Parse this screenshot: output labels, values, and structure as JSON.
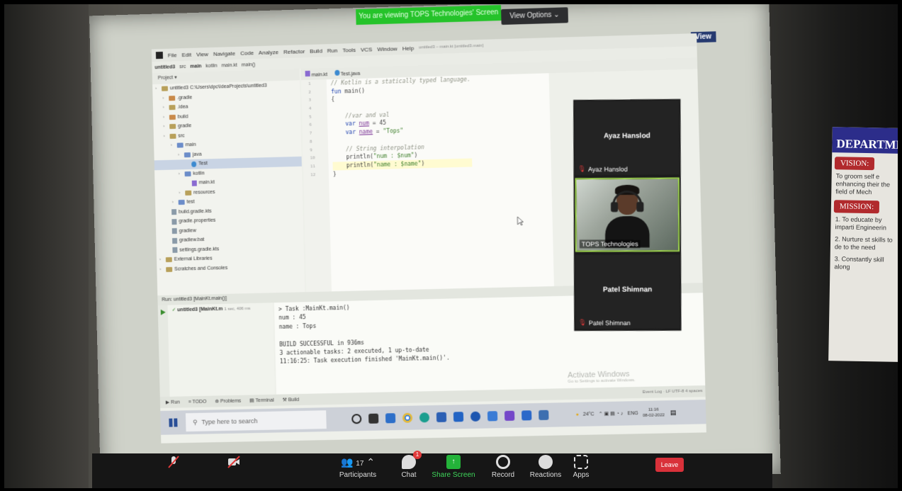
{
  "zoom": {
    "share_banner": "You are viewing TOPS Technologies' Screen",
    "view_options": "View Options ⌄",
    "view_label": "View",
    "participants": [
      {
        "name_large": "Ayaz Hanslod",
        "label": "Ayaz Hanslod",
        "has_video": false
      },
      {
        "name_large": "",
        "label": "TOPS Technologies",
        "has_video": true
      },
      {
        "name_large": "Patel Shimnan",
        "label": "Patel Shimnan",
        "has_video": false
      }
    ],
    "toolbar": {
      "participants_count": "17",
      "participants_label": "Participants",
      "chat_label": "Chat",
      "chat_badge": "1",
      "share_label": "Share Screen",
      "record_label": "Record",
      "reactions_label": "Reactions",
      "apps_label": "Apps",
      "leave_label": "Leave"
    }
  },
  "ide": {
    "menu": [
      "File",
      "Edit",
      "View",
      "Navigate",
      "Code",
      "Analyze",
      "Refactor",
      "Build",
      "Run",
      "Tools",
      "VCS",
      "Window",
      "Help"
    ],
    "window_path": "untitled3 – main.kt [untitled3.main]",
    "breadcrumb": [
      "untitled3",
      "src",
      "main",
      "kotlin",
      "main.kt",
      "main()"
    ],
    "project_header": "Project ▾",
    "tree": [
      {
        "label": "untitled3  C:\\Users\\dpc\\IdeaProjects\\untitled3",
        "indent": 0,
        "icon": "folder"
      },
      {
        "label": ".gradle",
        "indent": 1,
        "icon": "orange"
      },
      {
        "label": ".idea",
        "indent": 1,
        "icon": "folder"
      },
      {
        "label": "build",
        "indent": 1,
        "icon": "orange"
      },
      {
        "label": "gradle",
        "indent": 1,
        "icon": "folder"
      },
      {
        "label": "src",
        "indent": 1,
        "icon": "folder"
      },
      {
        "label": "main",
        "indent": 2,
        "icon": "blue"
      },
      {
        "label": "java",
        "indent": 3,
        "icon": "blue"
      },
      {
        "label": "Test",
        "indent": 4,
        "icon": "java",
        "selected": true
      },
      {
        "label": "kotlin",
        "indent": 3,
        "icon": "blue"
      },
      {
        "label": "main.kt",
        "indent": 4,
        "icon": "kt"
      },
      {
        "label": "resources",
        "indent": 3,
        "icon": "folder"
      },
      {
        "label": "test",
        "indent": 2,
        "icon": "blue"
      },
      {
        "label": "build.gradle.kts",
        "indent": 1,
        "icon": "file"
      },
      {
        "label": "gradle.properties",
        "indent": 1,
        "icon": "file"
      },
      {
        "label": "gradlew",
        "indent": 1,
        "icon": "file"
      },
      {
        "label": "gradlew.bat",
        "indent": 1,
        "icon": "file"
      },
      {
        "label": "settings.gradle.kts",
        "indent": 1,
        "icon": "file"
      },
      {
        "label": "External Libraries",
        "indent": 0,
        "icon": "folder"
      },
      {
        "label": "Scratches and Consoles",
        "indent": 0,
        "icon": "folder"
      }
    ],
    "editor_tabs": [
      "main.kt",
      "Test.java"
    ],
    "line_numbers": [
      "1",
      "2",
      "3",
      "4",
      "5",
      "6",
      "7",
      "8",
      "9",
      "10",
      "11",
      "12"
    ],
    "code": {
      "l1": "// Kotlin is a statically typed language.",
      "l2_kw": "fun ",
      "l2_rest": "main()",
      "l3": "{",
      "l4": "",
      "l5": "    //var and val",
      "l6_kw": "    var ",
      "l6_var": "num",
      "l6_rest": " = 45",
      "l7_kw": "    var ",
      "l7_var": "name",
      "l7_rest": " = ",
      "l7_str": "\"Tops\"",
      "l8": "",
      "l9": "    // String interpolation",
      "l10_a": "    println(",
      "l10_str": "\"num : $num\"",
      "l10_b": ")",
      "l11_a": "    println(",
      "l11_str": "\"name : $name\"",
      "l11_b": ")",
      "l12": "}"
    },
    "run_header": "Run:   untitled3 [MainKt.main()]",
    "run_item": "untitled3 [MainKt.m",
    "run_time": "1 sec, 406 ms",
    "console": [
      "> Task :MainKt.main()",
      "num : 45",
      "name : Tops",
      "",
      "BUILD SUCCESSFUL in 936ms",
      "3 actionable tasks: 2 executed, 1 up-to-date",
      "11:16:25: Task execution finished 'MainKt.main()'."
    ],
    "watermark": "Activate Windows",
    "watermark_sub": "Go to Settings to activate Windows.",
    "bottom_tabs": [
      "▶ Run",
      "≡ TODO",
      "⊕ Problems",
      "▤ Terminal",
      "⚒ Build"
    ],
    "status_right": "LF  UTF-8  4 spaces",
    "event_log": "Event Log"
  },
  "taskbar": {
    "search_placeholder": "Type here to search",
    "weather": "24°C",
    "lang": "ENG",
    "time": "11:16",
    "date": "08-02-2022"
  },
  "poster": {
    "title": "DEPARTMENT",
    "vision": "VISION:",
    "vision_text": "To groom self e enhancing their the field of Mech",
    "mission": "MISSION:",
    "m1": "1. To educate by imparti Engineerin",
    "m2": "2. Nurture st skills to de to the need",
    "m3": "3. Constantly skill along"
  }
}
